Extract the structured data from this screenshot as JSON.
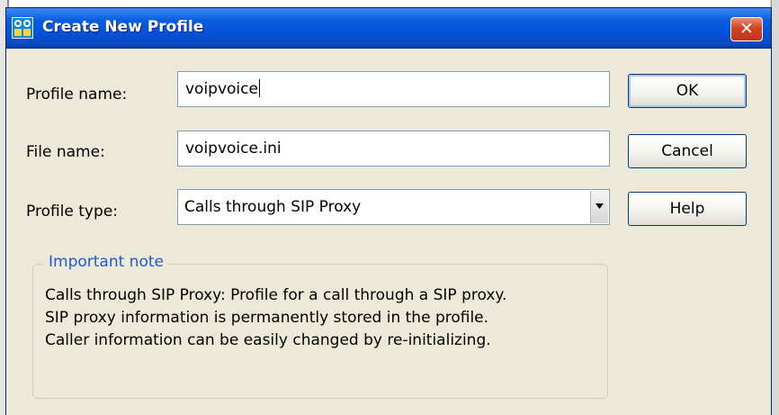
{
  "window": {
    "title": "Create New Profile",
    "close_label": "✕"
  },
  "form": {
    "profile_name_label": "Profile name:",
    "profile_name_value": "voipvoice",
    "file_name_label": "File name:",
    "file_name_value": "voipvoice.ini",
    "profile_type_label": "Profile type:",
    "profile_type_value": "Calls through SIP Proxy"
  },
  "buttons": {
    "ok": "OK",
    "cancel": "Cancel",
    "help": "Help"
  },
  "note": {
    "title": "Important note",
    "lines": [
      "Calls through SIP Proxy: Profile for a call through a SIP proxy.",
      "SIP proxy information is permanently stored in the profile.",
      "Caller information can be easily changed by re-initializing."
    ]
  },
  "colors": {
    "titlebar": "#0452d8",
    "dialog_bg": "#ece9d8",
    "group_title": "#1d5ad0",
    "close_button": "#d2421e"
  }
}
